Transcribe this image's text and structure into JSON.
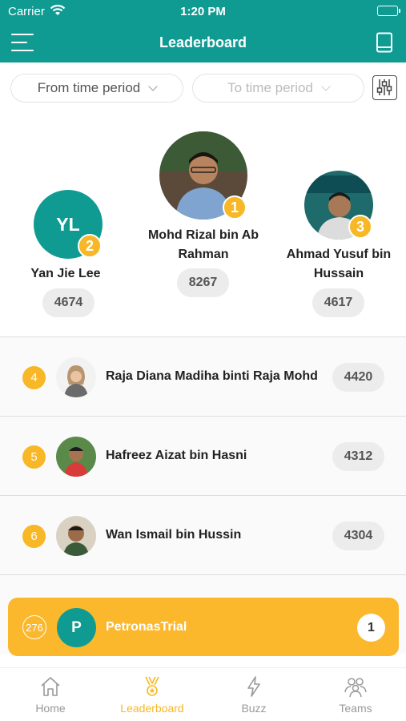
{
  "status_bar": {
    "carrier": "Carrier",
    "time": "1:20 PM"
  },
  "header": {
    "title": "Leaderboard"
  },
  "filters": {
    "from_label": "From time period",
    "to_label": "To time period"
  },
  "podium": {
    "first": {
      "rank": "1",
      "name": "Mohd Rizal bin Ab Rahman",
      "score": "8267"
    },
    "second": {
      "rank": "2",
      "initials": "YL",
      "name": "Yan Jie Lee",
      "score": "4674"
    },
    "third": {
      "rank": "3",
      "name": "Ahmad Yusuf bin Hussain",
      "score": "4617"
    }
  },
  "list": [
    {
      "rank": "4",
      "name": "Raja Diana Madiha binti Raja Mohd",
      "score": "4420"
    },
    {
      "rank": "5",
      "name": "Hafreez Aizat bin Hasni",
      "score": "4312"
    },
    {
      "rank": "6",
      "name": "Wan Ismail bin Hussin",
      "score": "4304"
    }
  ],
  "my_rank": {
    "rank": "276",
    "initial": "P",
    "name": "PetronasTrial",
    "score": "1"
  },
  "tabs": [
    {
      "label": "Home",
      "icon": "home-icon"
    },
    {
      "label": "Leaderboard",
      "icon": "trophy-icon",
      "active": true
    },
    {
      "label": "Buzz",
      "icon": "lightning-icon"
    },
    {
      "label": "Teams",
      "icon": "team-icon"
    }
  ],
  "colors": {
    "primary": "#0f9b92",
    "accent": "#f7b726",
    "tab_inactive": "#999999"
  }
}
